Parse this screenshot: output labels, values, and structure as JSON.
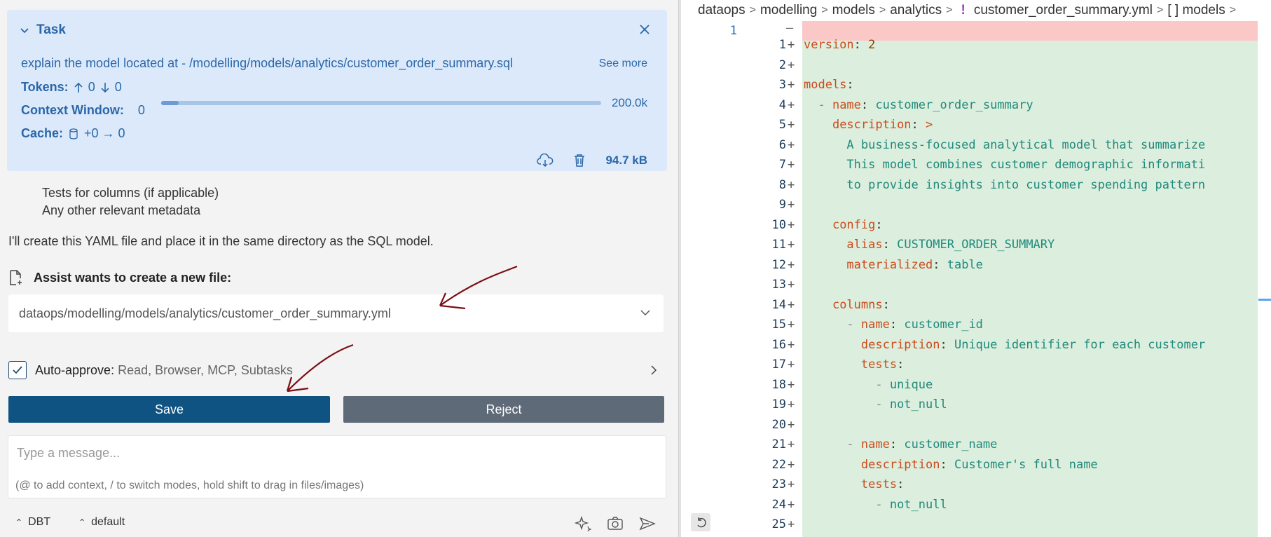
{
  "task": {
    "title": "Task",
    "description": "explain the model located at - /modelling/models/analytics/customer_order_summary.sql",
    "see_more": "See more",
    "tokens_label": "Tokens:",
    "tokens_up": "0",
    "tokens_down": "0",
    "context_label": "Context Window:",
    "context_used": "0",
    "context_max": "200.0k",
    "context_fraction": 0.04,
    "cache_label": "Cache:",
    "cache_value": "+0 → 0",
    "size": "94.7 kB"
  },
  "chat": {
    "line1": "Tests for columns (if applicable)",
    "line2": "Any other relevant metadata",
    "line3": "I'll create this YAML file and place it in the same directory as the SQL model.",
    "new_file_label": "Assist wants to create a new file:",
    "file_path": "dataops/modelling/models/analytics/customer_order_summary.yml"
  },
  "auto_approve": {
    "label": "Auto-approve:",
    "items": "Read, Browser, MCP, Subtasks"
  },
  "buttons": {
    "save": "Save",
    "reject": "Reject"
  },
  "composer": {
    "placeholder": "Type a message...",
    "hint": "(@ to add context, / to switch modes, hold shift to drag in files/images)"
  },
  "bottom_bar": {
    "mode": "DBT",
    "profile": "default"
  },
  "editor": {
    "breadcrumb": [
      "dataops",
      "modelling",
      "models",
      "analytics",
      "customer_order_summary.yml",
      "[ ] models"
    ],
    "deleted_line_number": "1",
    "lines": [
      {
        "n": "1",
        "indent": "",
        "key": "version",
        "sep": ": ",
        "val": "2"
      },
      {
        "n": "2",
        "indent": "",
        "key": "",
        "sep": "",
        "val": ""
      },
      {
        "n": "3",
        "indent": "",
        "key": "models",
        "sep": ":",
        "val": ""
      },
      {
        "n": "4",
        "indent": "  - ",
        "key": "name",
        "sep": ": ",
        "val": "customer_order_summary"
      },
      {
        "n": "5",
        "indent": "    ",
        "key": "description",
        "sep": ": ",
        "val": ">"
      },
      {
        "n": "6",
        "indent": "      ",
        "key": "",
        "sep": "",
        "val": "A business-focused analytical model that summarize"
      },
      {
        "n": "7",
        "indent": "      ",
        "key": "",
        "sep": "",
        "val": "This model combines customer demographic informati"
      },
      {
        "n": "8",
        "indent": "      ",
        "key": "",
        "sep": "",
        "val": "to provide insights into customer spending pattern"
      },
      {
        "n": "9",
        "indent": "",
        "key": "",
        "sep": "",
        "val": ""
      },
      {
        "n": "10",
        "indent": "    ",
        "key": "config",
        "sep": ":",
        "val": ""
      },
      {
        "n": "11",
        "indent": "      ",
        "key": "alias",
        "sep": ": ",
        "val": "CUSTOMER_ORDER_SUMMARY"
      },
      {
        "n": "12",
        "indent": "      ",
        "key": "materialized",
        "sep": ": ",
        "val": "table"
      },
      {
        "n": "13",
        "indent": "",
        "key": "",
        "sep": "",
        "val": ""
      },
      {
        "n": "14",
        "indent": "    ",
        "key": "columns",
        "sep": ":",
        "val": ""
      },
      {
        "n": "15",
        "indent": "      - ",
        "key": "name",
        "sep": ": ",
        "val": "customer_id"
      },
      {
        "n": "16",
        "indent": "        ",
        "key": "description",
        "sep": ": ",
        "val": "Unique identifier for each customer"
      },
      {
        "n": "17",
        "indent": "        ",
        "key": "tests",
        "sep": ":",
        "val": ""
      },
      {
        "n": "18",
        "indent": "          - ",
        "key": "",
        "sep": "",
        "val": "unique"
      },
      {
        "n": "19",
        "indent": "          - ",
        "key": "",
        "sep": "",
        "val": "not_null"
      },
      {
        "n": "20",
        "indent": "",
        "key": "",
        "sep": "",
        "val": ""
      },
      {
        "n": "21",
        "indent": "      - ",
        "key": "name",
        "sep": ": ",
        "val": "customer_name"
      },
      {
        "n": "22",
        "indent": "        ",
        "key": "description",
        "sep": ": ",
        "val": "Customer's full name"
      },
      {
        "n": "23",
        "indent": "        ",
        "key": "tests",
        "sep": ":",
        "val": ""
      },
      {
        "n": "24",
        "indent": "          - ",
        "key": "",
        "sep": "",
        "val": "not_null"
      },
      {
        "n": "25",
        "indent": "",
        "key": "",
        "sep": "",
        "val": ""
      }
    ]
  },
  "colors": {
    "accent": "#0f5383",
    "task_bg": "#dce9fb",
    "added": "#dceedd",
    "deleted": "#fbc8c8",
    "annotation": "#7a0f14"
  },
  "icons": [
    "chevron-down-icon",
    "close-icon",
    "arrow-up-icon",
    "arrow-down-icon",
    "database-icon",
    "cloud-download-icon",
    "trash-icon",
    "new-file-icon",
    "check-icon",
    "chevron-right-icon",
    "sparkle-icon",
    "camera-icon",
    "send-icon",
    "undo-icon"
  ]
}
